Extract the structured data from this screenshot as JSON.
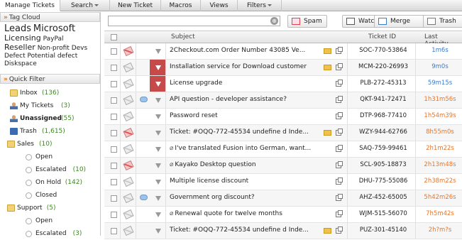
{
  "nav": {
    "tabs": [
      {
        "label": "Manage Tickets",
        "active": true
      },
      {
        "label": "Search",
        "dropdown": true
      },
      {
        "label": "New Ticket"
      },
      {
        "label": "Macros"
      },
      {
        "label": "Views"
      },
      {
        "label": "Filters",
        "dropdown": true
      }
    ]
  },
  "tag_cloud": {
    "title": "Tag Cloud",
    "tags": [
      {
        "text": "Leads",
        "size": 1
      },
      {
        "text": "Microsoft",
        "size": 1
      },
      {
        "text": "Licensing",
        "size": 2
      },
      {
        "text": "PayPal",
        "size": 3
      },
      {
        "text": "Reseller",
        "size": 2
      },
      {
        "text": "Non-profit",
        "size": 3
      },
      {
        "text": "Devs",
        "size": 3
      },
      {
        "text": "Defect",
        "size": 3
      },
      {
        "text": "Potential defect",
        "size": 3
      },
      {
        "text": "Diskspace",
        "size": 3
      }
    ]
  },
  "quick_filter": {
    "title": "Quick Filter",
    "items": [
      {
        "label": "Inbox",
        "count": "(136)",
        "icon": "folder-icon"
      },
      {
        "label": "My Tickets",
        "count": "(3)",
        "icon": "user-icon"
      },
      {
        "label": "Unassigned",
        "count": "(55)",
        "icon": "user-icon",
        "bold": true
      },
      {
        "label": "Trash",
        "count": "(1,615)",
        "icon": "trash-icon"
      },
      {
        "label": "Sales",
        "count": "(10)",
        "icon": "folder-icon"
      },
      {
        "label": "Open",
        "count": "",
        "icon": "radio-icon"
      },
      {
        "label": "Escalated",
        "count": "(10)",
        "icon": "radio-icon"
      },
      {
        "label": "On Hold",
        "count": "(142)",
        "icon": "radio-icon"
      },
      {
        "label": "Closed",
        "count": "",
        "icon": "radio-icon"
      },
      {
        "label": "Support",
        "count": "(5)",
        "icon": "folder-icon"
      },
      {
        "label": "Open",
        "count": "",
        "icon": "radio-icon"
      },
      {
        "label": "Escalated",
        "count": "(3)",
        "icon": "radio-icon"
      }
    ]
  },
  "toolbar": {
    "search_placeholder": "",
    "buttons": [
      {
        "label": "Spam",
        "icon": "spam-icon"
      },
      {
        "label": "Watch",
        "icon": "watch-icon"
      },
      {
        "label": "Merge",
        "icon": "merge-icon"
      },
      {
        "label": "Trash",
        "icon": "trash-icon"
      }
    ]
  },
  "table": {
    "headers": {
      "subject": "Subject",
      "ticket_id": "Ticket ID",
      "last_activity": "Last Activity"
    },
    "rows": [
      {
        "subject": "2Checkout.com Order Number 43085 Ve...",
        "ticket_id": "SOC-770-53864",
        "last_activity": "1m6s",
        "activity_color": "#3b7bc8",
        "flag": "red",
        "priority": "none",
        "bubble": false,
        "clip": false,
        "mail": true
      },
      {
        "subject": "Installation service for Download customer",
        "ticket_id": "MCM-220-26993",
        "last_activity": "9m0s",
        "activity_color": "#3b7bc8",
        "flag": "grey",
        "priority": "urgent",
        "bubble": false,
        "clip": false,
        "mail": true
      },
      {
        "subject": "License upgrade",
        "ticket_id": "PLB-272-45313",
        "last_activity": "59m15s",
        "activity_color": "#3b7bc8",
        "flag": "grey",
        "priority": "urgent",
        "bubble": false,
        "clip": false,
        "mail": false
      },
      {
        "subject": "API question - developer assistance?",
        "ticket_id": "QKT-941-72471",
        "last_activity": "1h31m56s",
        "activity_color": "#e8752a",
        "flag": "grey",
        "priority": "none",
        "bubble": true,
        "clip": false,
        "mail": false
      },
      {
        "subject": "Password reset",
        "ticket_id": "DTP-968-77410",
        "last_activity": "1h54m39s",
        "activity_color": "#e8752a",
        "flag": "grey",
        "priority": "none",
        "bubble": false,
        "clip": false,
        "mail": false
      },
      {
        "subject": "Ticket: #OQQ-772-45534 undefine d Inde...",
        "ticket_id": "WZY-944-62766",
        "last_activity": "8h55m0s",
        "activity_color": "#e8752a",
        "flag": "red",
        "priority": "none",
        "bubble": false,
        "clip": false,
        "mail": true
      },
      {
        "subject": "I've translated Fusion into German, want...",
        "ticket_id": "SAQ-759-99461",
        "last_activity": "2h1m22s",
        "activity_color": "#e8752a",
        "flag": "grey",
        "priority": "none",
        "bubble": false,
        "clip": true,
        "mail": false
      },
      {
        "subject": "Kayako Desktop question",
        "ticket_id": "SCL-905-18873",
        "last_activity": "2h13m48s",
        "activity_color": "#e8752a",
        "flag": "red",
        "priority": "none",
        "bubble": false,
        "clip": true,
        "mail": false
      },
      {
        "subject": "Multiple license discount",
        "ticket_id": "DHU-775-55086",
        "last_activity": "2h38m22s",
        "activity_color": "#e8752a",
        "flag": "grey",
        "priority": "none",
        "bubble": false,
        "clip": false,
        "mail": false
      },
      {
        "subject": "Government org discount?",
        "ticket_id": "AHZ-452-65005",
        "last_activity": "5h42m26s",
        "activity_color": "#e8752a",
        "flag": "grey",
        "priority": "none",
        "bubble": true,
        "clip": false,
        "mail": false
      },
      {
        "subject": "Renewal quote for twelve months",
        "ticket_id": "WJM-515-56070",
        "last_activity": "7h5m42s",
        "activity_color": "#e8752a",
        "flag": "grey",
        "priority": "none",
        "bubble": false,
        "clip": true,
        "mail": false
      },
      {
        "subject": "Ticket: #OQQ-772-45534 undefine d Inde...",
        "ticket_id": "PUZ-301-45140",
        "last_activity": "2h?m?s",
        "activity_color": "#e8752a",
        "flag": "grey",
        "priority": "none",
        "bubble": false,
        "clip": false,
        "mail": true
      }
    ]
  }
}
